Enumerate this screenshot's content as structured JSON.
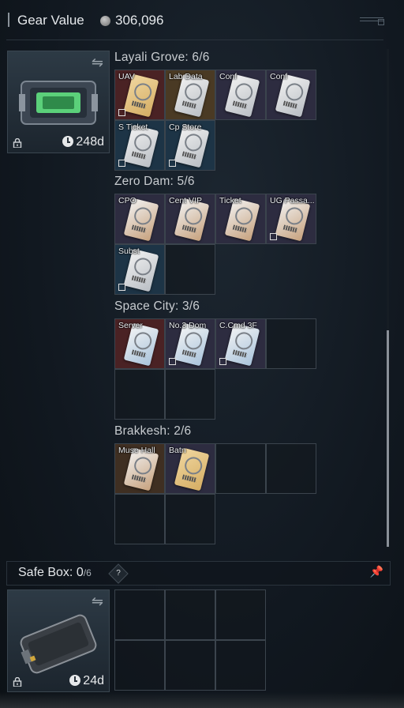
{
  "header": {
    "title": "Gear Value",
    "value": "306,096"
  },
  "top_container": {
    "timer": "248d",
    "icon": "swap-icon"
  },
  "sections": [
    {
      "title": "Layali Grove: 6/6",
      "items": [
        {
          "label": "UAV",
          "rarity": "red",
          "card": "gold-card",
          "marked": true
        },
        {
          "label": "Lab Data",
          "rarity": "gold",
          "card": "",
          "marked": false
        },
        {
          "label": "Conf",
          "rarity": "purple",
          "card": "",
          "marked": false
        },
        {
          "label": "Conf",
          "rarity": "purple",
          "card": "",
          "marked": false
        },
        {
          "label": "S Ticket",
          "rarity": "blue",
          "card": "",
          "marked": true
        },
        {
          "label": "Cp Store",
          "rarity": "blue",
          "card": "",
          "marked": true
        }
      ]
    },
    {
      "title": "Zero Dam: 5/6",
      "items": [
        {
          "label": "CPO",
          "rarity": "purple",
          "card": "brown-card",
          "marked": false
        },
        {
          "label": "Cent VIP",
          "rarity": "purple",
          "card": "brown-card",
          "marked": false
        },
        {
          "label": "Ticket",
          "rarity": "purple",
          "card": "brown-card",
          "marked": false
        },
        {
          "label": "UG Passa...",
          "rarity": "purple",
          "card": "brown-card",
          "marked": true
        },
        {
          "label": "Subst",
          "rarity": "blue",
          "card": "",
          "marked": true
        }
      ]
    },
    {
      "title": "Space City: 3/6",
      "items": [
        {
          "label": "Server",
          "rarity": "red",
          "card": "blue-card",
          "marked": false
        },
        {
          "label": "No.3 Dom",
          "rarity": "purple",
          "card": "blue-card",
          "marked": true
        },
        {
          "label": "C.Cmd 3F",
          "rarity": "purple",
          "card": "blue-card",
          "marked": true
        }
      ]
    },
    {
      "title": "Brakkesh: 2/6",
      "items": [
        {
          "label": "Muse Hall",
          "rarity": "brown",
          "card": "brown-card",
          "marked": false
        },
        {
          "label": "Batn",
          "rarity": "purple",
          "card": "gold-card",
          "marked": false
        }
      ]
    }
  ],
  "safe_box": {
    "title": "Safe Box: ",
    "count": "0",
    "capacity": "/6",
    "help": "?",
    "timer": "24d"
  }
}
